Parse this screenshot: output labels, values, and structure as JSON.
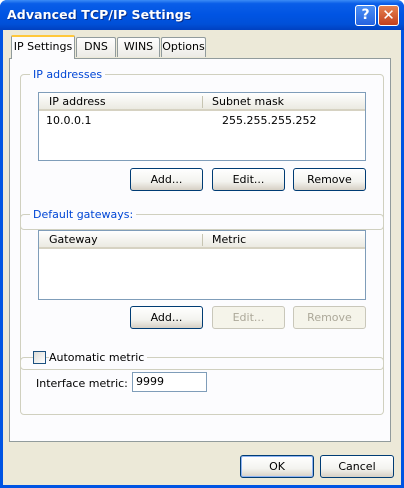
{
  "window": {
    "title": "Advanced TCP/IP Settings",
    "help_glyph": "?",
    "close_glyph": "✕"
  },
  "tabs": [
    {
      "label": "IP Settings",
      "active": true
    },
    {
      "label": "DNS",
      "active": false
    },
    {
      "label": "WINS",
      "active": false
    },
    {
      "label": "Options",
      "active": false
    }
  ],
  "ip_addresses": {
    "group_label": "IP addresses",
    "columns": [
      "IP address",
      "Subnet mask"
    ],
    "rows": [
      {
        "ip": "10.0.0.1",
        "mask": "255.255.255.252"
      }
    ],
    "add_label": "Add...",
    "edit_label": "Edit...",
    "remove_label": "Remove"
  },
  "gateways": {
    "group_label": "Default gateways:",
    "columns": [
      "Gateway",
      "Metric"
    ],
    "rows": [],
    "add_label": "Add...",
    "edit_label": "Edit...",
    "remove_label": "Remove"
  },
  "metric": {
    "automatic_label": "Automatic metric",
    "automatic_checked": false,
    "interface_label": "Interface metric:",
    "interface_value": "9999"
  },
  "footer": {
    "ok_label": "OK",
    "cancel_label": "Cancel"
  },
  "colors": {
    "title_bar": "#0054e3",
    "dialog_bg": "#ece9d8",
    "group_label": "#0046d5",
    "active_tab_accent": "#ffc83c"
  }
}
